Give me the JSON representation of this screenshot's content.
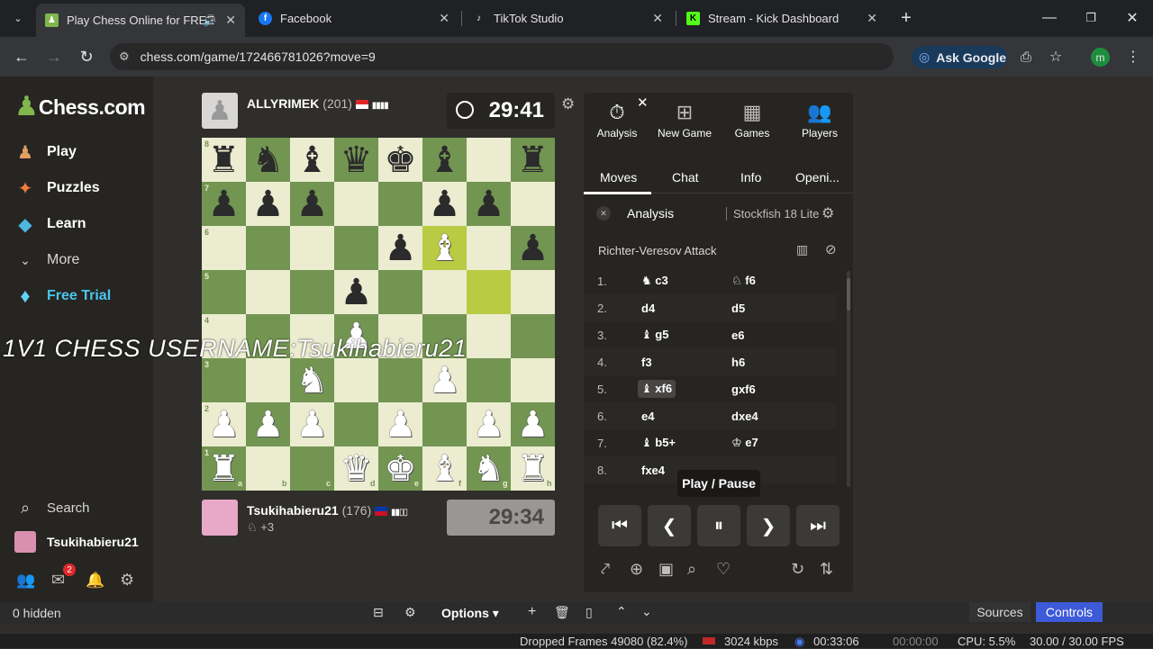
{
  "browser": {
    "tabs": [
      {
        "title": "Play Chess Online for FREE",
        "icon": "chess-favicon",
        "active": true
      },
      {
        "title": "Facebook",
        "icon": "facebook-favicon"
      },
      {
        "title": "TikTok Studio",
        "icon": "tiktok-favicon"
      },
      {
        "title": "Stream - Kick Dashboard",
        "icon": "kick-favicon"
      }
    ],
    "url": "chess.com/game/172466781026?move=9",
    "ask_google": "Ask Google",
    "profile_initial": "m"
  },
  "sidebar": {
    "logo": "Chess.com",
    "items": [
      {
        "label": "Play",
        "icon": "play-pawn-icon"
      },
      {
        "label": "Puzzles",
        "icon": "puzzle-icon"
      },
      {
        "label": "Learn",
        "icon": "learn-icon"
      },
      {
        "label": "More",
        "icon": "chevron-down-icon"
      },
      {
        "label": "Free Trial",
        "icon": "diamond-icon"
      }
    ],
    "search": "Search",
    "username": "Tsukihabieru21",
    "mail_badge": "2"
  },
  "game": {
    "top_player": {
      "name": "ALLYRIMEK",
      "rating": "(201)",
      "clock": "29:41"
    },
    "bottom_player": {
      "name": "Tsukihabieru21",
      "rating": "(176)",
      "material": "+3",
      "clock": "29:34"
    },
    "files": [
      "a",
      "b",
      "c",
      "d",
      "e",
      "f",
      "g",
      "h"
    ],
    "ranks": [
      "8",
      "7",
      "6",
      "5",
      "4",
      "3",
      "2",
      "1"
    ],
    "board": [
      [
        "r",
        "n",
        "b",
        "q",
        "k",
        "b",
        "",
        "r"
      ],
      [
        "p",
        "p",
        "p",
        "",
        "",
        "p",
        "p",
        ""
      ],
      [
        "",
        "",
        "",
        "",
        "p",
        "B",
        "",
        "p"
      ],
      [
        "",
        "",
        "",
        "p",
        "",
        "",
        "",
        ""
      ],
      [
        "",
        "",
        "",
        "P",
        "",
        "",
        "",
        ""
      ],
      [
        "",
        "",
        "N",
        "",
        "",
        "P",
        "",
        ""
      ],
      [
        "P",
        "P",
        "P",
        "",
        "P",
        "",
        "P",
        "P"
      ],
      [
        "R",
        "",
        "",
        "Q",
        "K",
        "B",
        "N",
        "R"
      ]
    ]
  },
  "overlay_text": "1V1 CHESS USERNAME:Tsukihabieru21",
  "panel": {
    "top_tabs": [
      {
        "label": "Analysis",
        "icon": "stopwatch-icon"
      },
      {
        "label": "New Game",
        "icon": "plus-icon"
      },
      {
        "label": "Games",
        "icon": "board-icon"
      },
      {
        "label": "Players",
        "icon": "players-icon"
      }
    ],
    "sub_tabs": [
      "Moves",
      "Chat",
      "Info",
      "Openi..."
    ],
    "analysis_label": "Analysis",
    "engine": "Stockfish 18 Lite",
    "opening": "Richter-Veresov Attack",
    "moves": [
      {
        "n": "1.",
        "w": "c3",
        "wp": "♞",
        "b": "f6",
        "bp": "♘"
      },
      {
        "n": "2.",
        "w": "d4",
        "wp": "",
        "b": "d5",
        "bp": ""
      },
      {
        "n": "3.",
        "w": "g5",
        "wp": "♝",
        "b": "e6",
        "bp": ""
      },
      {
        "n": "4.",
        "w": "f3",
        "wp": "",
        "b": "h6",
        "bp": ""
      },
      {
        "n": "5.",
        "w": "xf6",
        "wp": "♝",
        "b": "gxf6",
        "bp": ""
      },
      {
        "n": "6.",
        "w": "e4",
        "wp": "",
        "b": "dxe4",
        "bp": ""
      },
      {
        "n": "7.",
        "w": "b5+",
        "wp": "♝",
        "b": "e7",
        "bp": "♔"
      },
      {
        "n": "8.",
        "w": "fxe4",
        "wp": "",
        "b": "",
        "bp": ""
      }
    ],
    "tooltip": "Play / Pause"
  },
  "obs": {
    "hidden": "0 hidden",
    "options": "Options",
    "sources": "Sources",
    "controls": "Controls",
    "dropped": "Dropped Frames 49080 (82.4%)",
    "kbps": "3024 kbps",
    "time1": "00:33:06",
    "time2": "00:00:00",
    "cpu": "CPU: 5.5%",
    "fps": "30.00 / 30.00 FPS"
  }
}
